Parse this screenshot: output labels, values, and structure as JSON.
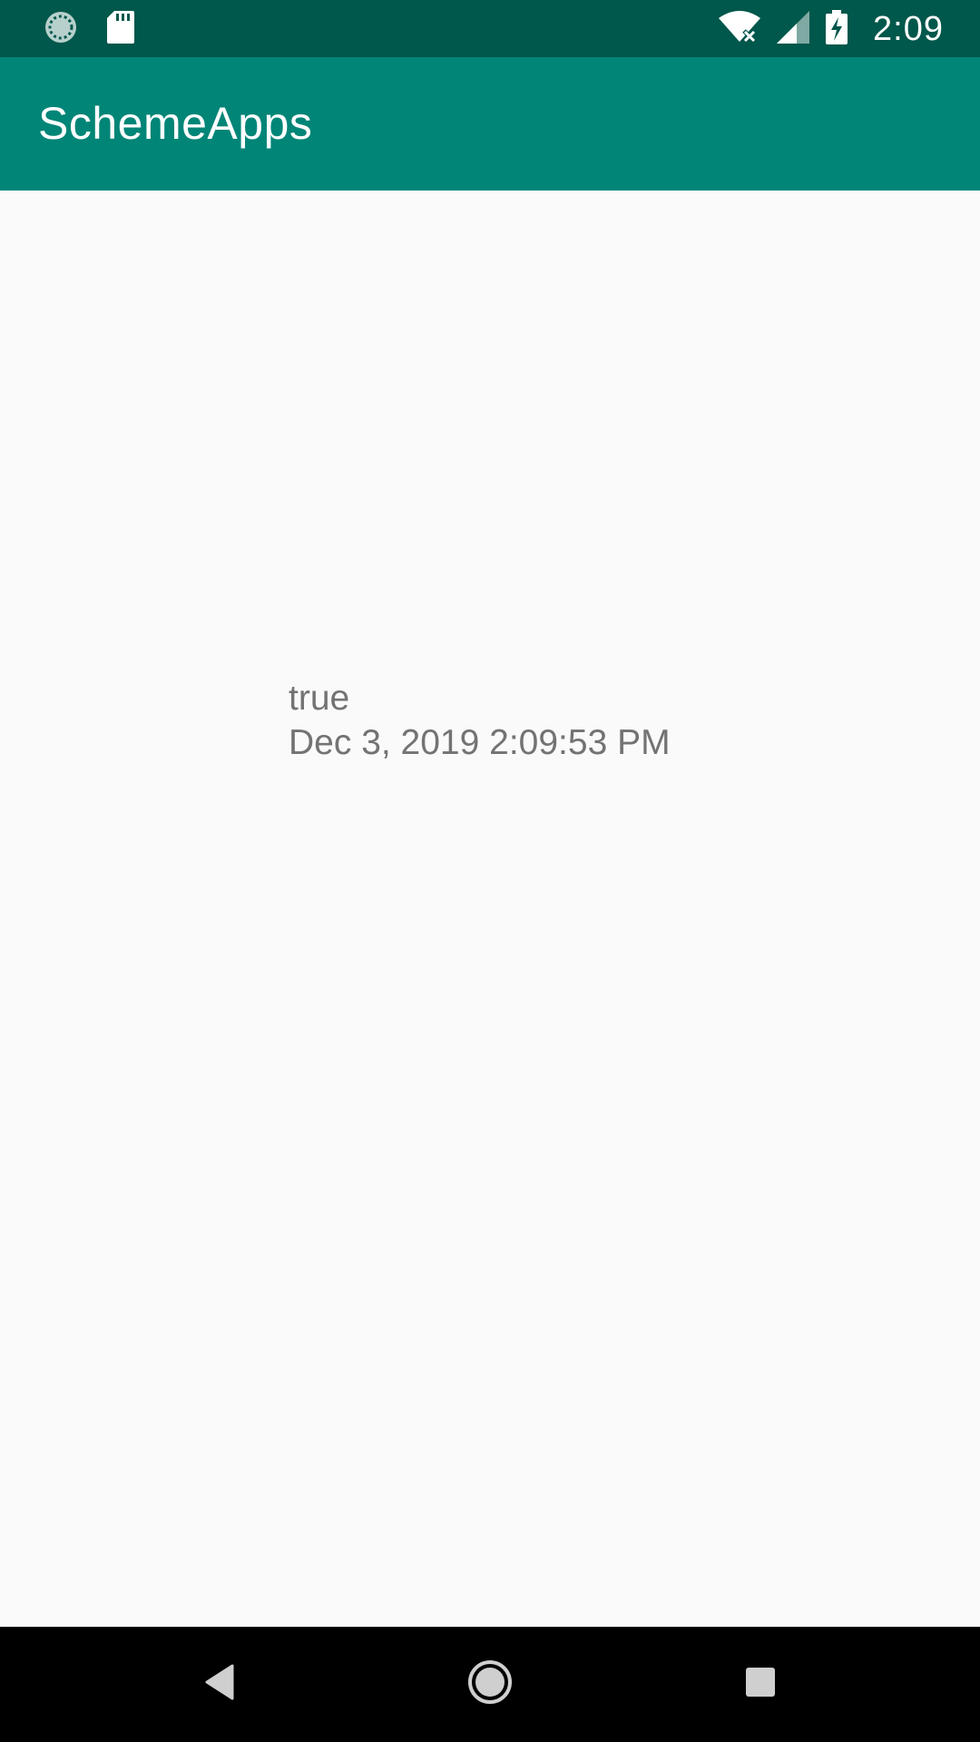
{
  "status_bar": {
    "time": "2:09",
    "icons": [
      "sync-icon",
      "sd-card-icon",
      "wifi-off-icon",
      "cell-signal-icon",
      "battery-charging-icon"
    ]
  },
  "app_bar": {
    "title": "SchemeApps"
  },
  "content": {
    "line1": "true",
    "line2": "Dec 3, 2019 2:09:53 PM"
  },
  "nav_bar": {
    "buttons": [
      "back-icon",
      "home-icon",
      "recents-icon"
    ]
  },
  "colors": {
    "status_bar": "#00574b",
    "app_bar": "#008577",
    "background": "#fafafa",
    "text": "#737373",
    "nav_bar": "#000000"
  }
}
